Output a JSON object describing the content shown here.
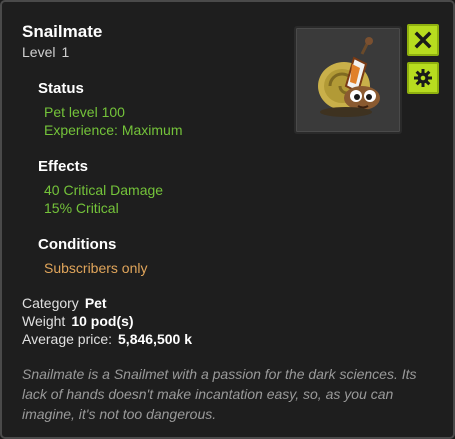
{
  "item": {
    "name": "Snailmate",
    "level_label": "Level",
    "level_value": "1"
  },
  "status": {
    "heading": "Status",
    "lines": [
      "Pet level 100",
      "Experience: Maximum"
    ]
  },
  "effects": {
    "heading": "Effects",
    "lines": [
      {
        "amount": "40",
        "text": "Critical Damage"
      },
      {
        "amount": "15%",
        "text": "Critical"
      }
    ]
  },
  "conditions": {
    "heading": "Conditions",
    "lines": [
      "Subscribers only"
    ]
  },
  "details": {
    "category_label": "Category",
    "category_value": "Pet",
    "weight_label": "Weight",
    "weight_value": "10 pod(s)",
    "price_label": "Average price:",
    "price_value": "5,846,500 k"
  },
  "description": "Snailmate is a Snailmet with a passion for the dark sciences. Its lack of hands doesn't make incantation easy, so, as you can imagine, it's not too dangerous.",
  "icons": {
    "close": "close-icon",
    "settings": "gear-icon",
    "portrait": "snailmate-portrait"
  },
  "colors": {
    "accent": "#b7dc1f",
    "effect_green": "#74c33a",
    "condition_orange": "#e0a55b"
  }
}
